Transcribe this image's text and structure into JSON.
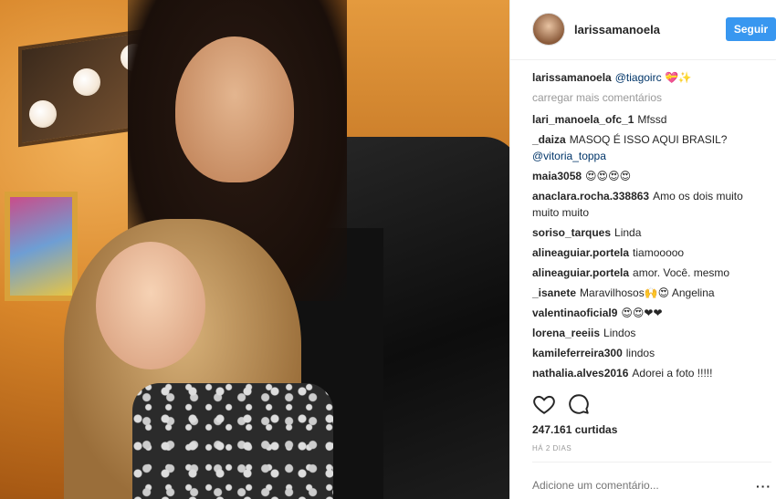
{
  "post": {
    "owner": "larissamanoela",
    "follow_label": "Seguir",
    "caption": {
      "user": "larissamanoela",
      "mention": "@tiagoirc",
      "emoji": "💝✨"
    },
    "load_more": "carregar mais comentários",
    "comments": [
      {
        "user": "lari_manoela_ofc_1",
        "text": "Mfssd"
      },
      {
        "user": "_daiza",
        "text": "MASOQ É ISSO AQUI BRASIL?",
        "mention": "@vitoria_toppa"
      },
      {
        "user": "maia3058",
        "text": "😍😍😍😍"
      },
      {
        "user": "anaclara.rocha.338863",
        "text": "Amo os dois muito muito muito"
      },
      {
        "user": "soriso_tarques",
        "text": "Linda"
      },
      {
        "user": "alineaguiar.portela",
        "text": "tiamooooo"
      },
      {
        "user": "alineaguiar.portela",
        "text": "amor. Você. mesmo"
      },
      {
        "user": "_isanete",
        "text": "Maravilhosos🙌😍 Angelina"
      },
      {
        "user": "valentinaoficial9",
        "text": "😍😍❤❤"
      },
      {
        "user": "lorena_reeiis",
        "text": "Lindos"
      },
      {
        "user": "kamileferreira300",
        "text": "lindos"
      },
      {
        "user": "nathalia.alves2016",
        "text": "Adorei a foto !!!!!"
      }
    ],
    "likes": "247.161 curtidas",
    "time": "HÁ 2 DIAS",
    "add_comment_placeholder": "Adicione um comentário...",
    "more_label": "···",
    "icons": {
      "like": "heart-icon",
      "comment": "comment-icon",
      "more": "more-options-icon"
    },
    "colors": {
      "accent": "#3897f0",
      "mention": "#003569",
      "muted": "#999999"
    }
  }
}
